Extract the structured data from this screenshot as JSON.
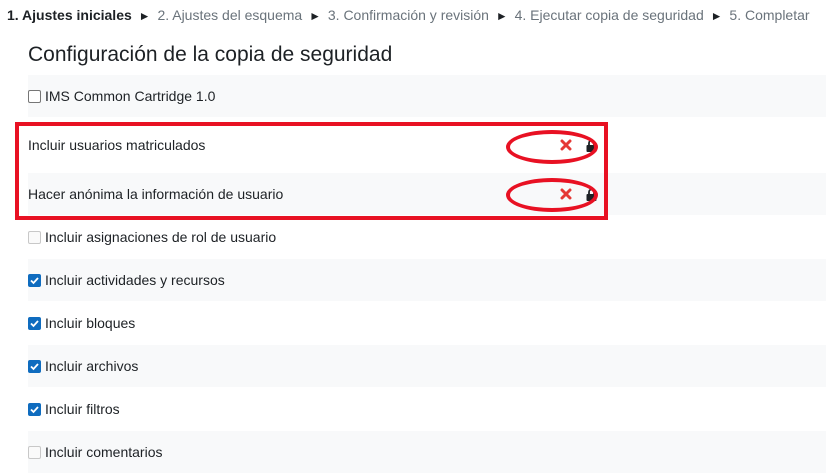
{
  "breadcrumb": {
    "steps": [
      "1. Ajustes iniciales",
      "2. Ajustes del esquema",
      "3. Confirmación y revisión",
      "4. Ejecutar copia de seguridad",
      "5. Completar"
    ],
    "separator": "►"
  },
  "page_title": "Configuración de la copia de seguridad",
  "settings": [
    {
      "label": "IMS Common Cartridge 1.0",
      "state": "unchecked"
    },
    {
      "label": "Incluir usuarios matriculados",
      "state": "locked-off"
    },
    {
      "label": "Hacer anónima la información de usuario",
      "state": "locked-off"
    },
    {
      "label": "Incluir asignaciones de rol de usuario",
      "state": "disabled"
    },
    {
      "label": "Incluir actividades y recursos",
      "state": "checked"
    },
    {
      "label": "Incluir bloques",
      "state": "checked"
    },
    {
      "label": "Incluir archivos",
      "state": "checked"
    },
    {
      "label": "Incluir filtros",
      "state": "checked"
    },
    {
      "label": "Incluir comentarios",
      "state": "disabled"
    }
  ],
  "colors": {
    "highlight_red": "#e81123",
    "checkbox_blue": "#0f6cbf",
    "cross_red": "#e53935"
  },
  "icons": {
    "no_value": "cross-icon",
    "locked": "lock-icon"
  }
}
